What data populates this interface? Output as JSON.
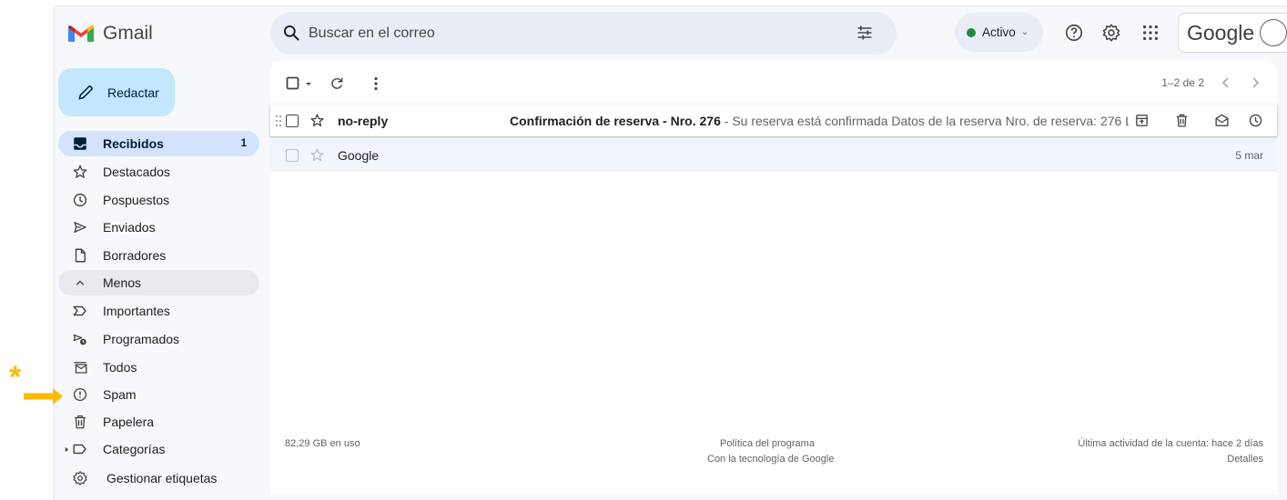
{
  "app": {
    "name": "Gmail"
  },
  "search": {
    "placeholder": "Buscar en el correo"
  },
  "status": {
    "label": "Activo",
    "color": "#1e8e3e"
  },
  "account": {
    "brand": "Google"
  },
  "compose": {
    "label": "Redactar"
  },
  "sidebar": {
    "items": [
      {
        "label": "Recibidos",
        "count": "1",
        "icon": "inbox-icon",
        "active": true
      },
      {
        "label": "Destacados",
        "icon": "star-icon"
      },
      {
        "label": "Pospuestos",
        "icon": "clock-icon"
      },
      {
        "label": "Enviados",
        "icon": "send-icon"
      },
      {
        "label": "Borradores",
        "icon": "draft-icon"
      },
      {
        "label": "Menos",
        "icon": "chevron-up-icon"
      },
      {
        "label": "Importantes",
        "icon": "important-icon"
      },
      {
        "label": "Programados",
        "icon": "scheduled-icon"
      },
      {
        "label": "Todos",
        "icon": "all-mail-icon"
      },
      {
        "label": "Spam",
        "icon": "spam-icon"
      },
      {
        "label": "Papelera",
        "icon": "trash-icon"
      },
      {
        "label": "Categorías",
        "icon": "label-icon"
      },
      {
        "label": "Gestionar etiquetas",
        "icon": "settings-gear-icon"
      }
    ]
  },
  "toolbar": {
    "pager": "1–2 de 2"
  },
  "emails": [
    {
      "sender": "no-reply",
      "subject": "Confirmación de reserva - Nro. 276",
      "snippet": " - Su reserva está confirmada Datos de la reserva Nro. de reserva: 276 L...",
      "unread": true
    },
    {
      "sender": "Google",
      "date": "5 mar",
      "unread": false
    }
  ],
  "footer": {
    "storage": "82,29 GB en uso",
    "policy": "Política del programa",
    "powered": "Con la tecnología de Google",
    "activity": "Última actividad de la cuenta: hace 2 días",
    "details": "Detalles"
  },
  "annotations": {
    "asterisk": "*",
    "color": "#fbbc04"
  }
}
